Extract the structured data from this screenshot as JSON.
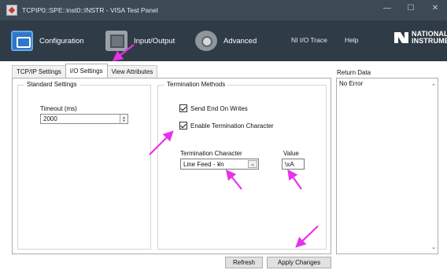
{
  "window": {
    "title": "TCPIP0::SPE::inst0::INSTR - VISA Test Panel",
    "minimize": "—",
    "maximize": "☐",
    "close": "✕"
  },
  "toolbar": {
    "configuration": "Configuration",
    "input_output": "Input/Output",
    "advanced": "Advanced",
    "ni_io_trace": "NI I/O Trace",
    "help": "Help",
    "logo_line1": "NATIONAL",
    "logo_line2": "INSTRUMENTS"
  },
  "tabs": [
    {
      "label": "TCP/IP Settings",
      "active": false
    },
    {
      "label": "I/O Settings",
      "active": true
    },
    {
      "label": "View Attributes",
      "active": false
    }
  ],
  "standard_settings": {
    "title": "Standard Settings",
    "timeout_label": "Timeout (ms)",
    "timeout_value": "2000"
  },
  "termination_methods": {
    "title": "Termination Methods",
    "send_end_label": "Send End On Writes",
    "send_end_checked": true,
    "enable_term_label": "Enable Termination Character",
    "enable_term_checked": true,
    "term_char_label": "Termination Character",
    "term_char_value": "Line Feed - ¥n",
    "value_label": "Value",
    "value_value": "\\xA"
  },
  "return_data": {
    "label": "Return Data",
    "text": "No Error"
  },
  "buttons": {
    "refresh": "Refresh",
    "apply": "Apply Changes"
  },
  "annotation_color": "#e832e8"
}
